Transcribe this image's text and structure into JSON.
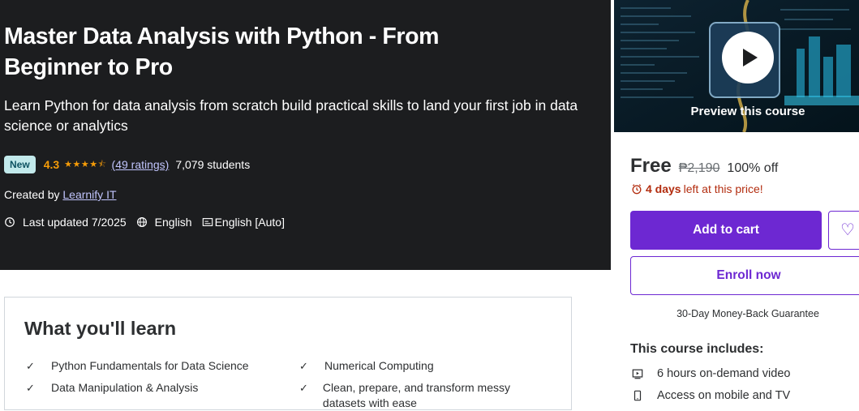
{
  "course": {
    "title": "Master Data Analysis with Python - From Beginner to Pro",
    "subtitle": "Learn Python for data analysis from scratch build practical skills to land your first job in data science or analytics",
    "badge": "New",
    "rating": "4.3",
    "rating_stars": 4.3,
    "ratings_count": "(49 ratings)",
    "students": "7,079 students",
    "created_prefix": "Created by",
    "instructor": "Learnify IT",
    "last_updated": "Last updated 7/2025",
    "language": "English",
    "captions": "English [Auto]"
  },
  "learn": {
    "heading": "What you'll learn",
    "items": [
      "Python Fundamentals for Data Science",
      "Numerical Computing",
      "Data Manipulation & Analysis",
      "Clean, prepare, and transform messy datasets with ease"
    ]
  },
  "sidebar": {
    "preview_label": "Preview this course",
    "price": "Free",
    "original_price": "₱2,190",
    "discount": "100% off",
    "timer_bold": "4 days",
    "timer_rest": "left at this price!",
    "add_to_cart": "Add to cart",
    "enroll": "Enroll now",
    "guarantee": "30-Day Money-Back Guarantee",
    "includes_heading": "This course includes:",
    "includes": [
      "6 hours on-demand video",
      "Access on mobile and TV"
    ]
  },
  "colors": {
    "hero_bg": "#1c1d1f",
    "accent": "#6d28d2",
    "star": "#f69c08",
    "link": "#c0c4fc",
    "badge_bg": "#c2e9eb",
    "timer": "#b32d0f"
  },
  "icons": [
    "alarm-icon",
    "globe-icon",
    "captions-icon",
    "clock-icon",
    "check-icon",
    "play-icon",
    "heart-icon",
    "video-icon",
    "mobile-icon"
  ]
}
